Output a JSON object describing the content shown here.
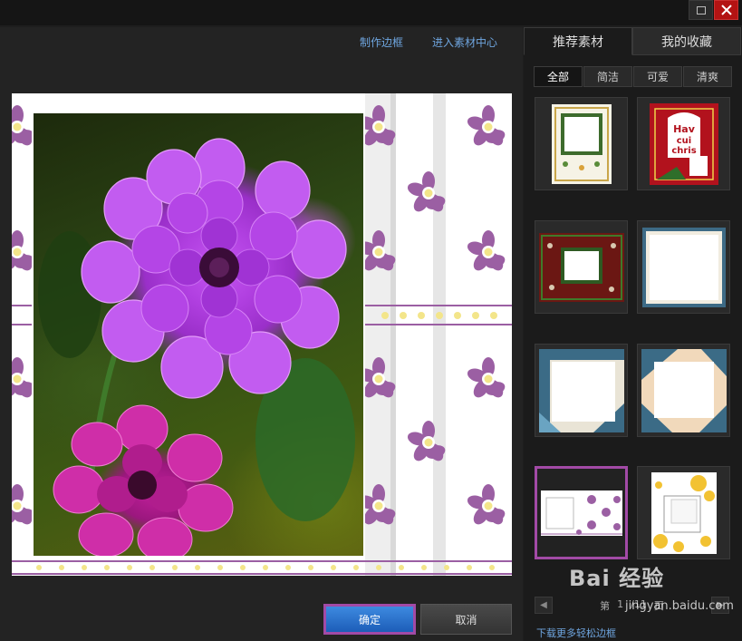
{
  "window": {
    "maximize_icon": "maximize-icon",
    "close_icon": "close-icon"
  },
  "toolbar": {
    "make_frame": "制作边框",
    "enter_material_center": "进入素材中心"
  },
  "buttons": {
    "ok": "确定",
    "cancel": "取消"
  },
  "panel": {
    "tabs": [
      {
        "label": "推荐素材",
        "active": true
      },
      {
        "label": "我的收藏",
        "active": false
      }
    ],
    "filters": [
      {
        "label": "全部",
        "active": true
      },
      {
        "label": "简洁",
        "active": false
      },
      {
        "label": "可爱",
        "active": false
      },
      {
        "label": "清爽",
        "active": false
      }
    ],
    "thumbnails": [
      {
        "name": "frame-thumb-floral-green",
        "selected": false
      },
      {
        "name": "frame-thumb-christmas-red",
        "selected": false,
        "text": "Hav cui chris"
      },
      {
        "name": "frame-thumb-dark-red-floral",
        "selected": false
      },
      {
        "name": "frame-thumb-blue-border",
        "selected": false
      },
      {
        "name": "frame-thumb-blue-corner",
        "selected": false
      },
      {
        "name": "frame-thumb-beige-corner",
        "selected": false
      },
      {
        "name": "frame-thumb-purple-flowers",
        "selected": true
      },
      {
        "name": "frame-thumb-yellow-flowers",
        "selected": false
      }
    ],
    "pager": {
      "prefix": "第",
      "current": "1",
      "total": "/11",
      "suffix": "页"
    },
    "more_link": "下载更多轻松边框"
  },
  "watermark": {
    "main": "Bai 经验",
    "sub": "jingyan.baidu.com"
  },
  "colors": {
    "accent_purple": "#a24aa6",
    "link_blue": "#6fa6e0",
    "flower_purple": "#9b5fa3",
    "ok_blue": "#2a6fcc",
    "close_red": "#b31313"
  }
}
